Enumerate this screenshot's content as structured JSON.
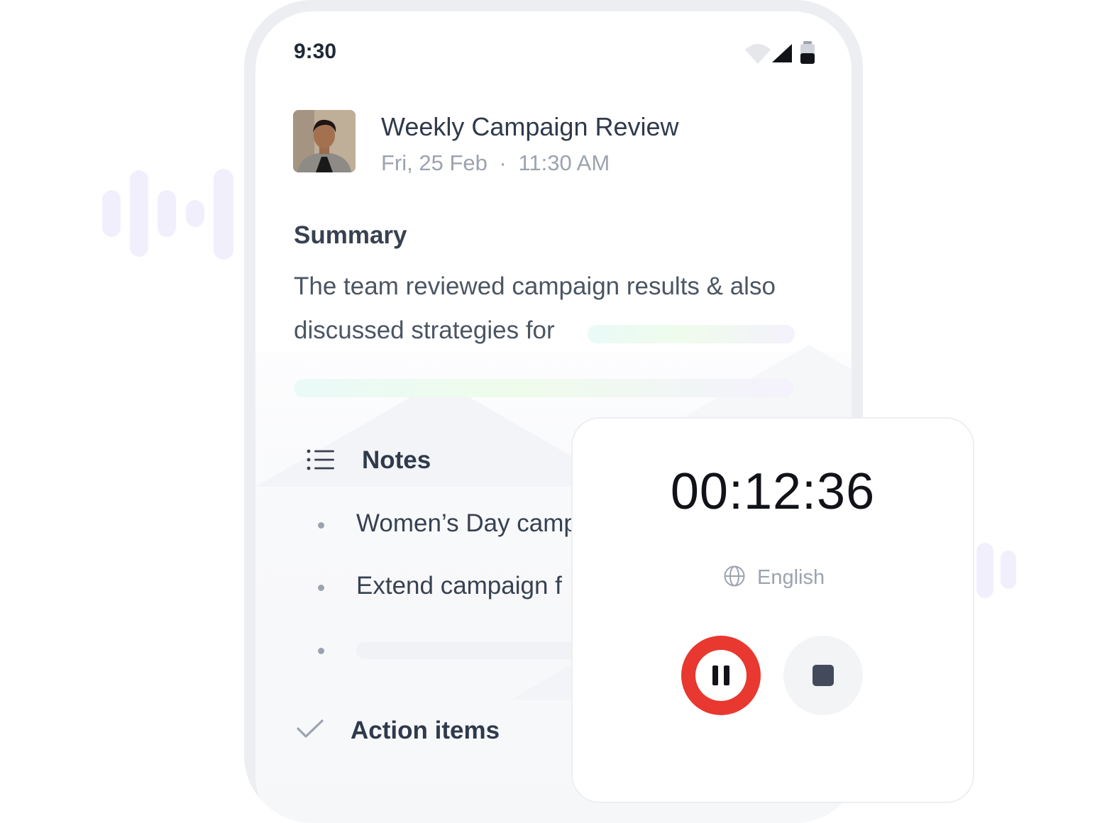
{
  "status_bar": {
    "time": "9:30",
    "icons": [
      "wifi-icon",
      "signal-icon",
      "battery-icon"
    ]
  },
  "meeting": {
    "title": "Weekly Campaign Review",
    "date": "Fri, 25 Feb",
    "separator": "·",
    "time": "11:30 AM"
  },
  "summary": {
    "heading": "Summary",
    "line1": "The team reviewed campaign results & also",
    "line2": "discussed strategies for"
  },
  "notes": {
    "heading": "Notes",
    "icon": "list-icon",
    "items": [
      "Women’s Day camp",
      "Extend campaign f"
    ]
  },
  "action_items": {
    "heading": "Action items",
    "icon": "check-icon"
  },
  "recorder": {
    "timer": "00:12:36",
    "language": "English",
    "language_icon": "globe-icon",
    "pause_icon": "pause-icon",
    "stop_icon": "stop-icon",
    "colors": {
      "record_accent": "#e8382f",
      "stop_fill": "#424a5c"
    }
  }
}
